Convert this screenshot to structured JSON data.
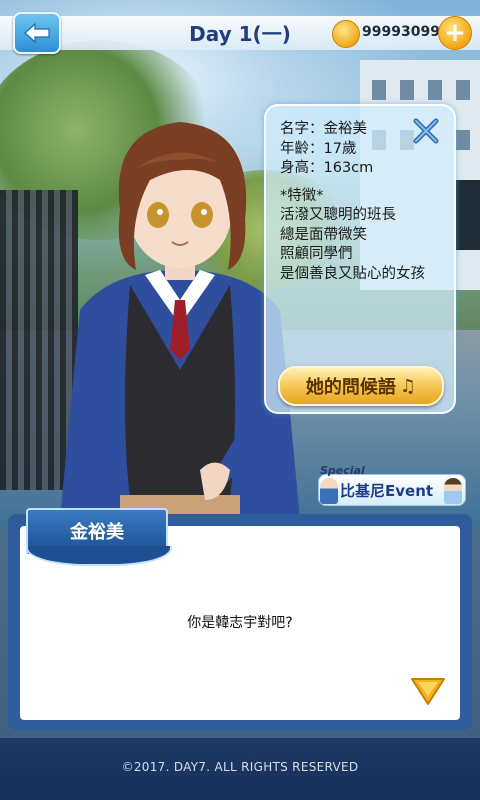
{
  "header": {
    "day_title": "Day 1(一)",
    "coins": "999930999",
    "add_symbol": "+"
  },
  "profile": {
    "name_line": "名字：金裕美",
    "age_line": "年齡：17歲",
    "height_line": "身高：163cm",
    "traits_heading": "*特徵*",
    "traits": [
      "活潑又聰明的班長",
      "總是面帶微笑",
      "照顧同學們",
      "是個善良又貼心的女孩"
    ],
    "greeting_button": "她的問候語",
    "greeting_note": "♫"
  },
  "event": {
    "special_tag": "Special",
    "label": "比基尼Event"
  },
  "dialogue": {
    "speaker": "金裕美",
    "line": "你是韓志宇對吧?"
  },
  "footer": {
    "copyright": "©2017. DAY7. ALL RIGHTS RESERVED"
  },
  "icons": {
    "back": "back-arrow-icon",
    "coin": "coin-icon",
    "close": "close-icon",
    "next": "next-arrow-icon"
  },
  "colors": {
    "accent_blue": "#2f5c9a",
    "title_blue": "#223f7a",
    "gold": "#f4c34c"
  }
}
